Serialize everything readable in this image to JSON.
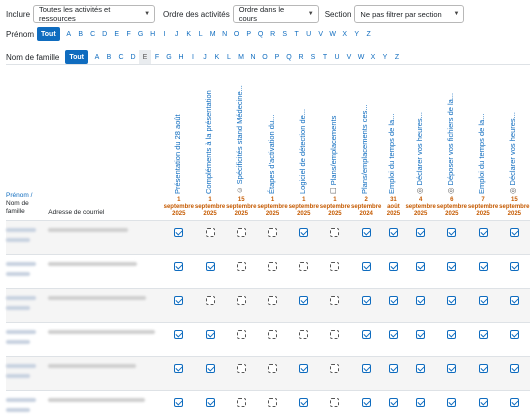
{
  "filters": {
    "include_label": "Inclure",
    "include_value": "Toutes les activités et ressources",
    "order_label": "Ordre des activités",
    "order_value": "Ordre dans le cours",
    "section_label": "Section",
    "section_value": "Ne pas filtrer par section"
  },
  "prenom_filter": {
    "label": "Prénom",
    "all": "Tout",
    "letters": [
      "A",
      "B",
      "C",
      "D",
      "E",
      "F",
      "G",
      "H",
      "I",
      "J",
      "K",
      "L",
      "M",
      "N",
      "O",
      "P",
      "Q",
      "R",
      "S",
      "T",
      "U",
      "V",
      "W",
      "X",
      "Y",
      "Z"
    ]
  },
  "nom_filter": {
    "label": "Nom de famille",
    "all": "Tout",
    "letters": [
      "A",
      "B",
      "C",
      "D",
      "E",
      "F",
      "G",
      "H",
      "I",
      "J",
      "K",
      "L",
      "M",
      "N",
      "O",
      "P",
      "Q",
      "R",
      "S",
      "T",
      "U",
      "V",
      "W",
      "X",
      "Y",
      "Z"
    ],
    "highlighted": "E"
  },
  "table": {
    "name_header_1": "Prénom /",
    "name_header_2": "Nom de",
    "name_header_3": "famille",
    "email_header": "Adresse de courriel",
    "activities": [
      {
        "title": "Présentation du 28 août",
        "icon": "",
        "day": "1",
        "month": "septembre",
        "year": "2025"
      },
      {
        "title": "Compléments à la présentation",
        "icon": "",
        "day": "1",
        "month": "septembre",
        "year": "2025"
      },
      {
        "title": "Spécificités stand Médecine...",
        "icon": "☺",
        "day": "15",
        "month": "septembre",
        "year": "2025"
      },
      {
        "title": "Étapes d'activation du...",
        "icon": "",
        "day": "1",
        "month": "septembre",
        "year": "2025"
      },
      {
        "title": "Logiciel de détection de...",
        "icon": "",
        "day": "1",
        "month": "septembre",
        "year": "2025"
      },
      {
        "title": "Plans/emplacements",
        "icon": "☐",
        "day": "1",
        "month": "septembre",
        "year": "2025"
      },
      {
        "title": "Plans/emplacements ces...",
        "icon": "",
        "day": "2",
        "month": "septembre",
        "year": "2024"
      },
      {
        "title": "Emploi du temps de la...",
        "icon": "",
        "day": "31",
        "month": "août",
        "year": "2025"
      },
      {
        "title": "Déclarer vos heures...",
        "icon": "◎",
        "day": "4",
        "month": "septembre",
        "year": "2025"
      },
      {
        "title": "Déposer vos fichiers de la...",
        "icon": "◎",
        "day": "6",
        "month": "septembre",
        "year": "2025"
      },
      {
        "title": "Emploi du temps de la...",
        "icon": "",
        "day": "7",
        "month": "septembre",
        "year": "2025"
      },
      {
        "title": "Déclarer vos heures...",
        "icon": "◎",
        "day": "15",
        "month": "septembre",
        "year": "2025"
      }
    ],
    "rows": [
      {
        "checks": [
          true,
          false,
          false,
          false,
          true,
          false,
          true,
          true,
          true,
          true,
          true,
          true
        ]
      },
      {
        "checks": [
          true,
          true,
          false,
          false,
          false,
          false,
          true,
          true,
          true,
          true,
          true,
          true
        ]
      },
      {
        "checks": [
          true,
          false,
          false,
          false,
          true,
          false,
          true,
          true,
          true,
          true,
          true,
          true
        ]
      },
      {
        "checks": [
          true,
          true,
          false,
          false,
          false,
          false,
          true,
          true,
          true,
          true,
          true,
          true
        ]
      },
      {
        "checks": [
          true,
          true,
          false,
          false,
          true,
          false,
          true,
          true,
          true,
          true,
          true,
          true
        ]
      },
      {
        "checks": [
          true,
          true,
          false,
          false,
          true,
          false,
          true,
          true,
          true,
          true,
          true,
          true
        ]
      }
    ]
  },
  "colors": {
    "link": "#0f6cbf",
    "date": "#c55a00",
    "active_bg": "#0f6cbf"
  }
}
